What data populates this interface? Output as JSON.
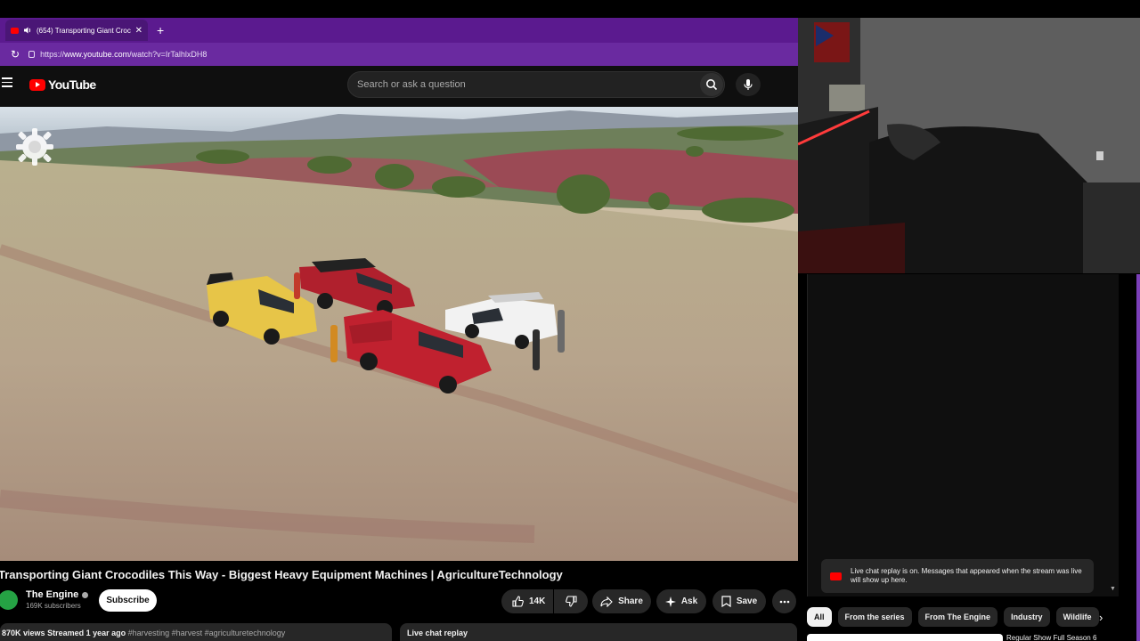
{
  "browser": {
    "tab_title": "(654) Transporting Giant Croc",
    "url_prefix": "https://",
    "url_host": "www.youtube.com",
    "url_path": "/watch?v=IrTalhlxDH8"
  },
  "header": {
    "logo_text": "YouTube",
    "search_placeholder": "Search or ask a question"
  },
  "video": {
    "title": "Transporting Giant Crocodiles This Way - Biggest Heavy Equipment Machines | AgricultureTechnology",
    "channel_name": "The Engine",
    "subscribers": "169K subscribers",
    "subscribe_label": "Subscribe",
    "likes": "14K",
    "share_label": "Share",
    "ask_label": "Ask",
    "save_label": "Save",
    "views": "870K views",
    "streamed": "Streamed 1 year ago",
    "hashtags": "#harvesting #harvest #agriculturetechnology",
    "live_chat_replay": "Live chat replay"
  },
  "chat": {
    "notice": "Live chat replay is on. Messages that appeared when the stream was live will show up here."
  },
  "chips": [
    "All",
    "From the series",
    "From The Engine",
    "Industry",
    "Wildlife"
  ],
  "next_video_title": "Regular Show Full Season 6",
  "colors": {
    "browser_purple": "#5b1a8f",
    "youtube_red": "#ff0000",
    "background": "#0f0f0f"
  }
}
